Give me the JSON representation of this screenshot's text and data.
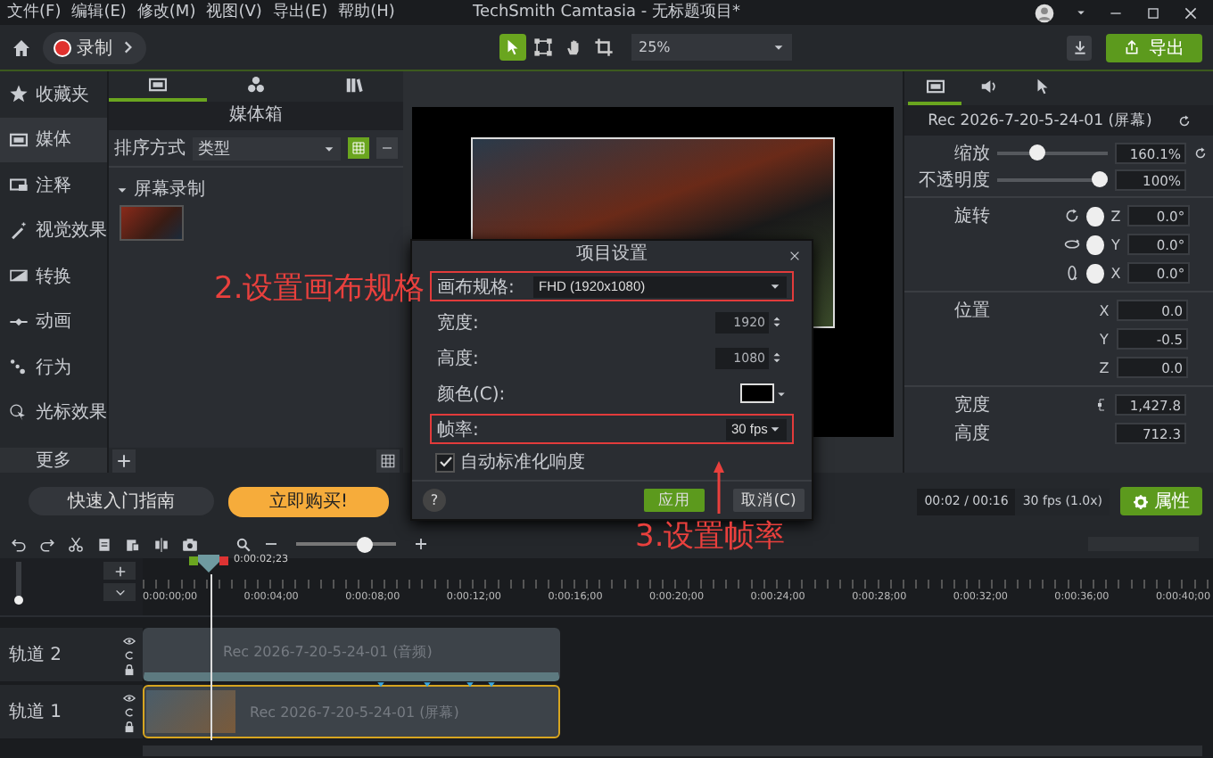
{
  "menu": [
    "文件(F)",
    "编辑(E)",
    "修改(M)",
    "视图(V)",
    "导出(E)",
    "帮助(H)"
  ],
  "window": {
    "title": "TechSmith Camtasia - 无标题项目*"
  },
  "toolbar": {
    "record": "录制",
    "tools": [
      {
        "selected": true
      },
      {
        "selected": false
      },
      {
        "selected": false
      },
      {
        "selected": false
      }
    ],
    "zoom": "25%",
    "export": "导出"
  },
  "sidebar": {
    "items": [
      {
        "label": "收藏夹",
        "selected": false
      },
      {
        "label": "媒体",
        "selected": true
      },
      {
        "label": "注释",
        "selected": false
      },
      {
        "label": "视觉效果",
        "selected": false
      },
      {
        "label": "转换",
        "selected": false
      },
      {
        "label": "动画",
        "selected": false
      },
      {
        "label": "行为",
        "selected": false
      },
      {
        "label": "光标效果",
        "selected": false
      }
    ],
    "more": "更多"
  },
  "media_bin": {
    "tabs": [
      {
        "selected": true
      },
      {
        "selected": false
      },
      {
        "selected": false
      }
    ],
    "title": "媒体箱",
    "sort_label": "排序方式",
    "sort_value": "类型",
    "group": "屏幕录制"
  },
  "properties": {
    "tabs": [
      {
        "selected": true
      },
      {
        "selected": false
      },
      {
        "selected": false
      }
    ],
    "clip_title": "Rec 2026-7-20-5-24-01 (屏幕)",
    "sliders": [
      {
        "label": "缩放",
        "level": 0.33,
        "value": "160.1%"
      },
      {
        "label": "不透明度",
        "level": 1,
        "value": "100%"
      }
    ],
    "rotation": {
      "label": "旋转",
      "axes": [
        {
          "axis": "Z",
          "value": "0.0°"
        },
        {
          "axis": "Y",
          "value": "0.0°"
        },
        {
          "axis": "X",
          "value": "0.0°"
        }
      ]
    },
    "position": {
      "label": "位置",
      "axes": [
        {
          "axis": "X",
          "value": "0.0"
        },
        {
          "axis": "Y",
          "value": "-0.5"
        },
        {
          "axis": "Z",
          "value": "0.0"
        }
      ]
    },
    "size": [
      {
        "label": "宽度",
        "value": "1,427.8"
      },
      {
        "label": "高度",
        "value": "712.3"
      }
    ]
  },
  "bottom": {
    "guide": "快速入门指南",
    "buy": "立即购买!",
    "time": "00:02 / 00:16",
    "fps": "30 fps (1.0x)",
    "properties_button": "属性"
  },
  "dialog": {
    "title": "项目设置",
    "fields": [
      {
        "kind": "select",
        "label": "画布规格:",
        "value": "FHD (1920x1080)",
        "highlighted": true
      },
      {
        "kind": "spin",
        "label": "宽度:",
        "value": "1920",
        "highlighted": false
      },
      {
        "kind": "spin",
        "label": "高度:",
        "value": "1080",
        "highlighted": false
      },
      {
        "kind": "color",
        "label": "颜色(C):",
        "highlighted": false
      },
      {
        "kind": "select",
        "label": "帧率:",
        "value": "30 fps",
        "highlighted": true
      }
    ],
    "checkbox": {
      "label": "自动标准化响度",
      "checked": true
    },
    "help": "?",
    "buttons": [
      {
        "label": "应用",
        "kind": "primary"
      },
      {
        "label": "取消(C)",
        "kind": "secondary"
      }
    ]
  },
  "timeline": {
    "zoom": {
      "level": 0.72
    },
    "track_height": {
      "level": 0
    },
    "playhead": "0:00:02;23",
    "ruler": [
      "0:00:00;00",
      "0:00:04;00",
      "0:00:08;00",
      "0:00:12;00",
      "0:00:16;00",
      "0:00:20;00",
      "0:00:24;00",
      "0:00:28;00",
      "0:00:32;00",
      "0:00:36;00",
      "0:00:40;00"
    ],
    "tracks": [
      {
        "name": "轨道 2",
        "clip": "Rec 2026-7-20-5-24-01 (音频)",
        "kind": "audio",
        "selected": false
      },
      {
        "name": "轨道 1",
        "clip": "Rec 2026-7-20-5-24-01 (屏幕)",
        "kind": "video",
        "selected": true
      }
    ]
  },
  "annotations": [
    {
      "text": "2.设置画布规格"
    },
    {
      "text": "3.设置帧率"
    }
  ]
}
